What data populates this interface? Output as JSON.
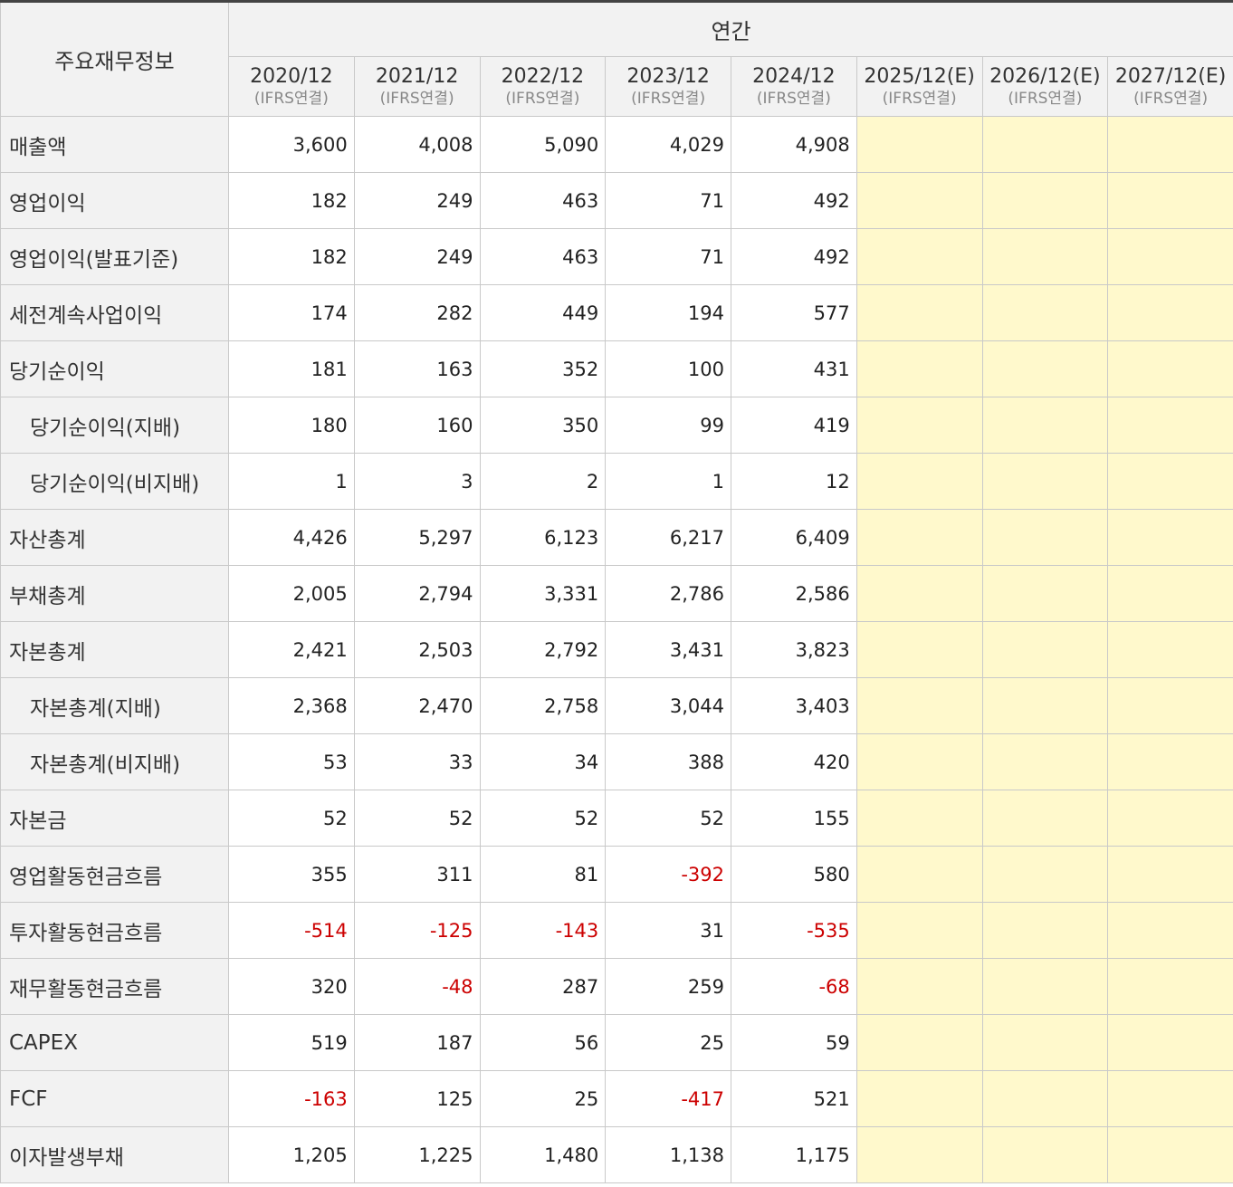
{
  "header": {
    "title": "주요재무정보",
    "group_label": "연간",
    "years": [
      {
        "year": "2020/12",
        "basis": "(IFRS연결)"
      },
      {
        "year": "2021/12",
        "basis": "(IFRS연결)"
      },
      {
        "year": "2022/12",
        "basis": "(IFRS연결)"
      },
      {
        "year": "2023/12",
        "basis": "(IFRS연결)"
      },
      {
        "year": "2024/12",
        "basis": "(IFRS연결)"
      },
      {
        "year": "2025/12(E)",
        "basis": "(IFRS연결)"
      },
      {
        "year": "2026/12(E)",
        "basis": "(IFRS연결)"
      },
      {
        "year": "2027/12(E)",
        "basis": "(IFRS연결)"
      }
    ]
  },
  "colors": {
    "negative": "#cc0000",
    "estimate_bg": "#fff9cc",
    "header_bg": "#f2f2f2"
  },
  "rows": [
    {
      "label": "매출액",
      "indent": false,
      "values": [
        "3,600",
        "4,008",
        "5,090",
        "4,029",
        "4,908",
        "",
        "",
        ""
      ]
    },
    {
      "label": "영업이익",
      "indent": false,
      "values": [
        "182",
        "249",
        "463",
        "71",
        "492",
        "",
        "",
        ""
      ]
    },
    {
      "label": "영업이익(발표기준)",
      "indent": false,
      "values": [
        "182",
        "249",
        "463",
        "71",
        "492",
        "",
        "",
        ""
      ]
    },
    {
      "label": "세전계속사업이익",
      "indent": false,
      "values": [
        "174",
        "282",
        "449",
        "194",
        "577",
        "",
        "",
        ""
      ]
    },
    {
      "label": "당기순이익",
      "indent": false,
      "values": [
        "181",
        "163",
        "352",
        "100",
        "431",
        "",
        "",
        ""
      ]
    },
    {
      "label": "당기순이익(지배)",
      "indent": true,
      "values": [
        "180",
        "160",
        "350",
        "99",
        "419",
        "",
        "",
        ""
      ]
    },
    {
      "label": "당기순이익(비지배)",
      "indent": true,
      "values": [
        "1",
        "3",
        "2",
        "1",
        "12",
        "",
        "",
        ""
      ]
    },
    {
      "label": "자산총계",
      "indent": false,
      "values": [
        "4,426",
        "5,297",
        "6,123",
        "6,217",
        "6,409",
        "",
        "",
        ""
      ]
    },
    {
      "label": "부채총계",
      "indent": false,
      "values": [
        "2,005",
        "2,794",
        "3,331",
        "2,786",
        "2,586",
        "",
        "",
        ""
      ]
    },
    {
      "label": "자본총계",
      "indent": false,
      "values": [
        "2,421",
        "2,503",
        "2,792",
        "3,431",
        "3,823",
        "",
        "",
        ""
      ]
    },
    {
      "label": "자본총계(지배)",
      "indent": true,
      "values": [
        "2,368",
        "2,470",
        "2,758",
        "3,044",
        "3,403",
        "",
        "",
        ""
      ]
    },
    {
      "label": "자본총계(비지배)",
      "indent": true,
      "values": [
        "53",
        "33",
        "34",
        "388",
        "420",
        "",
        "",
        ""
      ]
    },
    {
      "label": "자본금",
      "indent": false,
      "values": [
        "52",
        "52",
        "52",
        "52",
        "155",
        "",
        "",
        ""
      ]
    },
    {
      "label": "영업활동현금흐름",
      "indent": false,
      "values": [
        "355",
        "311",
        "81",
        "-392",
        "580",
        "",
        "",
        ""
      ]
    },
    {
      "label": "투자활동현금흐름",
      "indent": false,
      "values": [
        "-514",
        "-125",
        "-143",
        "31",
        "-535",
        "",
        "",
        ""
      ]
    },
    {
      "label": "재무활동현금흐름",
      "indent": false,
      "values": [
        "320",
        "-48",
        "287",
        "259",
        "-68",
        "",
        "",
        ""
      ]
    },
    {
      "label": "CAPEX",
      "indent": false,
      "values": [
        "519",
        "187",
        "56",
        "25",
        "59",
        "",
        "",
        ""
      ]
    },
    {
      "label": "FCF",
      "indent": false,
      "values": [
        "-163",
        "125",
        "25",
        "-417",
        "521",
        "",
        "",
        ""
      ]
    },
    {
      "label": "이자발생부채",
      "indent": false,
      "values": [
        "1,205",
        "1,225",
        "1,480",
        "1,138",
        "1,175",
        "",
        "",
        ""
      ]
    }
  ]
}
